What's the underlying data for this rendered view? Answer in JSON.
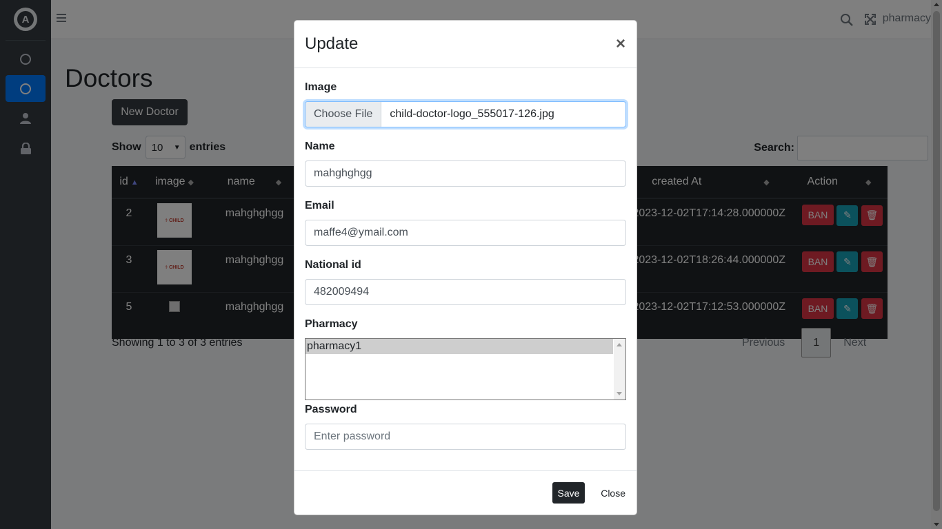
{
  "navbar": {
    "user": "pharmacy"
  },
  "page": {
    "title": "Doctors",
    "new_button": "New Doctor"
  },
  "table_controls": {
    "show_label": "Show",
    "entries_value": "10",
    "entries_label": "entries",
    "search_label": "Search:"
  },
  "table": {
    "headers": [
      "id",
      "image",
      "name",
      "created At",
      "Action"
    ],
    "rows": [
      {
        "id": "2",
        "name": "mahghghgg",
        "created_at": "2023-12-02T17:14:28.000000Z",
        "ban": "BAN"
      },
      {
        "id": "3",
        "name": "mahghghgg",
        "created_at": "2023-12-02T18:26:44.000000Z",
        "ban": "BAN"
      },
      {
        "id": "5",
        "name": "mahghghgg",
        "created_at": "2023-12-02T17:12:53.000000Z",
        "ban": "BAN"
      }
    ]
  },
  "footer": {
    "showing": "Showing 1 to 3 of 3 entries",
    "previous": "Previous",
    "page": "1",
    "next": "Next"
  },
  "modal": {
    "title": "Update",
    "close": "×",
    "image_label": "Image",
    "choose_file": "Choose File",
    "file_name": "child-doctor-logo_555017-126.jpg",
    "name_label": "Name",
    "name_value": "mahghghgg",
    "email_label": "Email",
    "email_value": "maffe4@ymail.com",
    "national_id_label": "National id",
    "national_id_value": "482009494",
    "pharmacy_label": "Pharmacy",
    "pharmacy_option": "pharmacy1",
    "password_label": "Password",
    "password_placeholder": "Enter password",
    "save": "Save",
    "close_button": "Close"
  },
  "icons": {
    "menu": "hamburger-icon",
    "search": "search-icon",
    "fullscreen": "expand-icon",
    "edit": "edit-icon",
    "delete": "trash-icon",
    "user": "user-icon",
    "lock": "lock-icon"
  },
  "colors": {
    "sidebar": "#343a40",
    "active": "#007bff",
    "danger": "#dc3545",
    "info": "#17a2b8",
    "dark": "#212529"
  }
}
